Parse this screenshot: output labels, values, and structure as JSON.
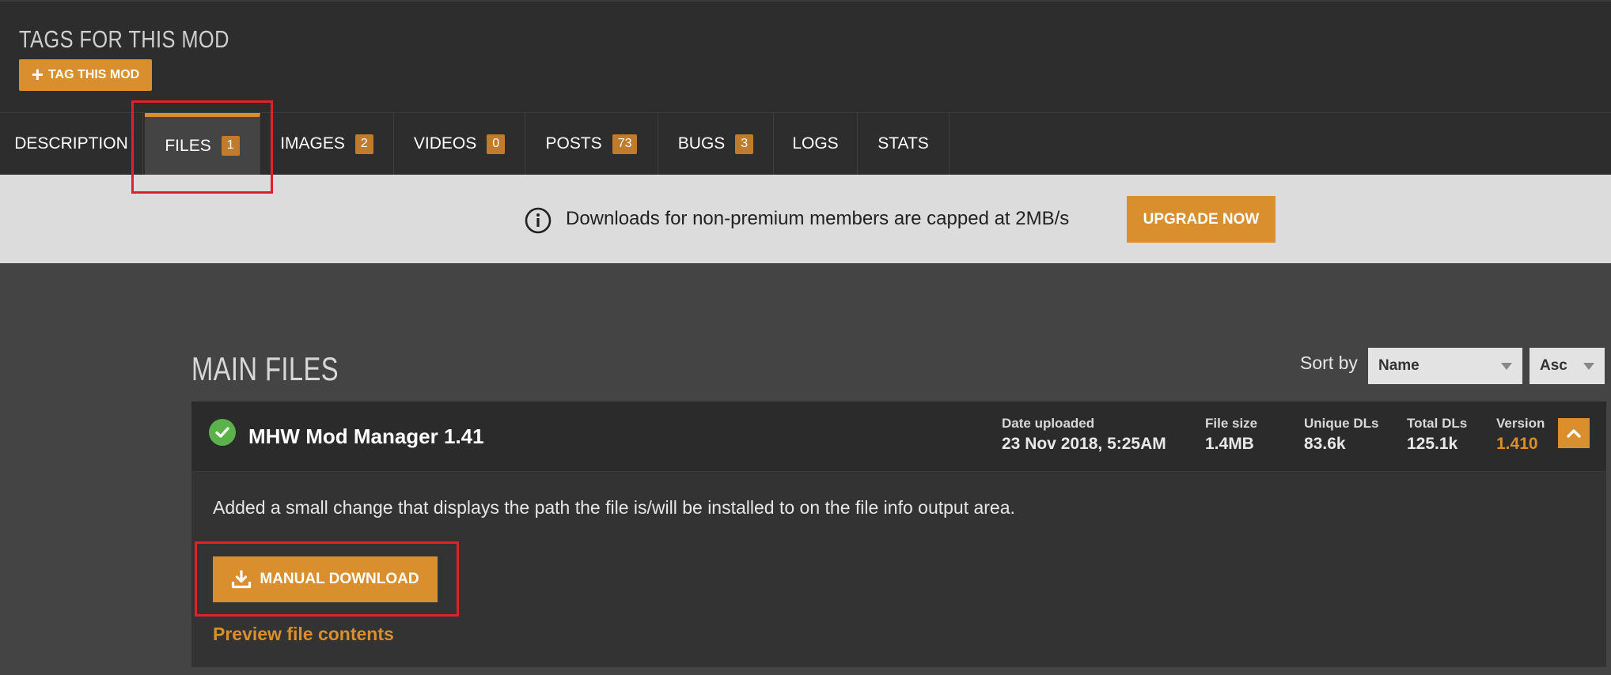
{
  "header": {
    "tags_title": "TAGS FOR THIS MOD",
    "tag_button_label": "TAG THIS MOD"
  },
  "tabs": [
    {
      "label": "DESCRIPTION",
      "count": null
    },
    {
      "label": "FILES",
      "count": "1",
      "active": true
    },
    {
      "label": "IMAGES",
      "count": "2"
    },
    {
      "label": "VIDEOS",
      "count": "0"
    },
    {
      "label": "POSTS",
      "count": "73"
    },
    {
      "label": "BUGS",
      "count": "3"
    },
    {
      "label": "LOGS",
      "count": null
    },
    {
      "label": "STATS",
      "count": null
    }
  ],
  "notice": {
    "text": "Downloads for non-premium members are capped at 2MB/s",
    "button_label": "UPGRADE NOW"
  },
  "main": {
    "title": "MAIN FILES",
    "sort_label": "Sort by",
    "sort_field": "Name",
    "sort_order": "Asc"
  },
  "file": {
    "name": "MHW Mod Manager 1.41",
    "date_label": "Date uploaded",
    "date_value": "23 Nov 2018, 5:25AM",
    "size_label": "File size",
    "size_value": "1.4MB",
    "unique_label": "Unique DLs",
    "unique_value": "83.6k",
    "total_label": "Total DLs",
    "total_value": "125.1k",
    "version_label": "Version",
    "version_value": "1.410",
    "description": "Added a small change that displays the path the file is/will be installed to on the file info output area.",
    "download_label": "MANUAL DOWNLOAD",
    "preview_label": "Preview file contents"
  },
  "colors": {
    "accent": "#d98f2e",
    "highlight": "#e0202a",
    "success": "#5bb24a"
  }
}
